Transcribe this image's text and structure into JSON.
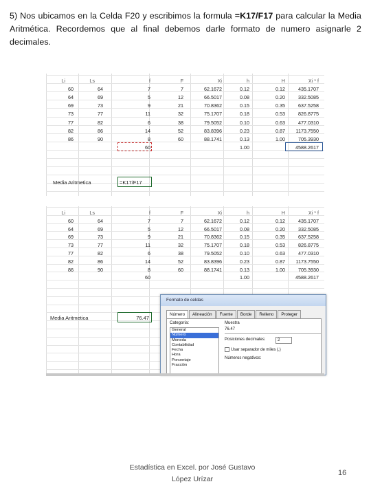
{
  "paragraph": {
    "prefix": "5) Nos ubicamos en la Celda F20 y escribimos la formula ",
    "formula": "=K17/F17",
    "suffix": " para calcular la Media Aritmética. Recordemos que al final debemos darle formato de numero asignarle 2 decimales."
  },
  "headers": [
    "Li",
    "Ls",
    "f",
    "F",
    "Xi",
    "h",
    "H",
    "Xi * f"
  ],
  "rows": [
    [
      "60",
      "64",
      "7",
      "7",
      "62.1672",
      "0.12",
      "0.12",
      "435.1707"
    ],
    [
      "64",
      "69",
      "5",
      "12",
      "66.5017",
      "0.08",
      "0.20",
      "332.5085"
    ],
    [
      "69",
      "73",
      "9",
      "21",
      "70.8362",
      "0.15",
      "0.35",
      "637.5258"
    ],
    [
      "73",
      "77",
      "11",
      "32",
      "75.1707",
      "0.18",
      "0.53",
      "826.8775"
    ],
    [
      "77",
      "82",
      "6",
      "38",
      "79.5052",
      "0.10",
      "0.63",
      "477.0310"
    ],
    [
      "82",
      "86",
      "14",
      "52",
      "83.8396",
      "0.23",
      "0.87",
      "1173.7550"
    ],
    [
      "86",
      "90",
      "8",
      "60",
      "88.1741",
      "0.13",
      "1.00",
      "705.3930"
    ]
  ],
  "totals": {
    "f": "60",
    "h": "1.00",
    "xif": "4588.2617"
  },
  "media_label": "Media Aritmetica",
  "formula_cell": "=K17/F17",
  "result_cell": "76.47",
  "dialog": {
    "title": "Formato de celdas",
    "tabs": [
      "Número",
      "Alineación",
      "Fuente",
      "Borde",
      "Relleno",
      "Proteger"
    ],
    "category_label": "Categoría:",
    "categories": [
      "General",
      "Número",
      "Moneda",
      "Contabilidad",
      "Fecha",
      "Hora",
      "Porcentaje",
      "Fracción"
    ],
    "selected_category": "Número",
    "sample_label": "Muestra",
    "sample_value": "76.47",
    "decimals_label": "Posiciones decimales:",
    "decimals_value": "2",
    "thousands_label": "Usar separador de miles (,)",
    "negatives_label": "Números negativos:"
  },
  "footer": {
    "line1": "Estadística en Excel. por José Gustavo",
    "line2": "López Urízar",
    "page": "16"
  }
}
